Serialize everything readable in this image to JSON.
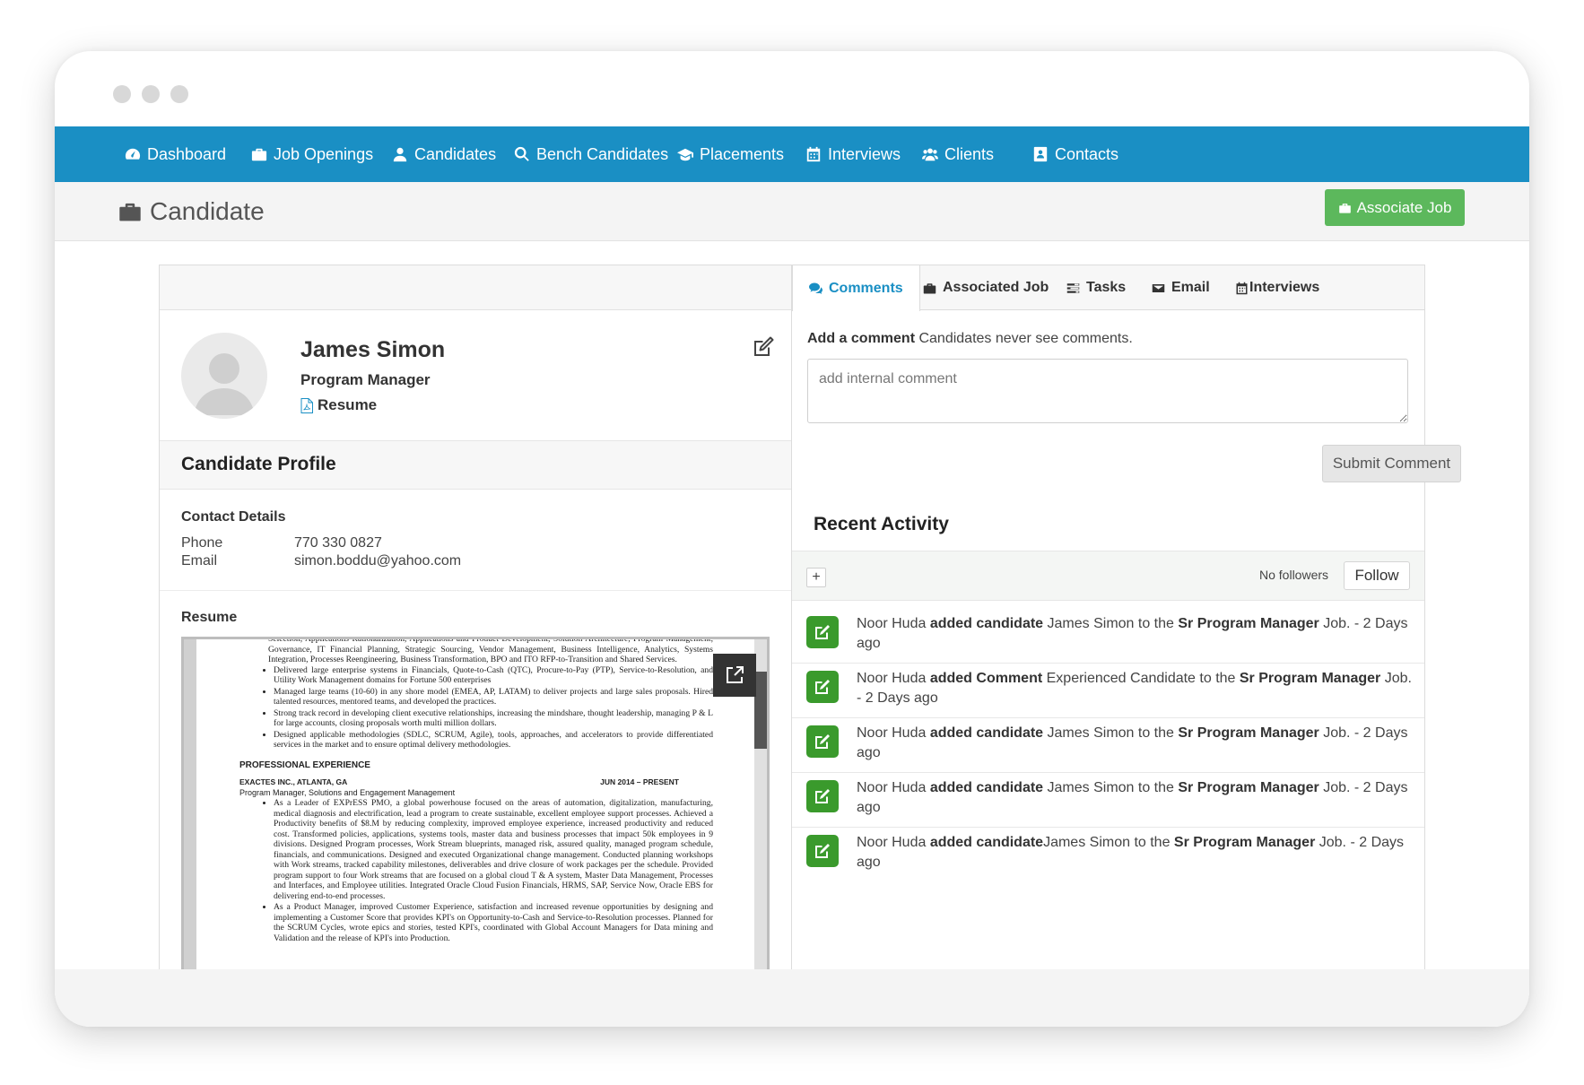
{
  "nav": {
    "items": [
      {
        "label": "Dashboard",
        "icon": "dashboard-icon"
      },
      {
        "label": "Job Openings",
        "icon": "briefcase-icon"
      },
      {
        "label": "Candidates",
        "icon": "user-icon"
      },
      {
        "label": "Bench Candidates",
        "icon": "search-icon"
      },
      {
        "label": "Placements",
        "icon": "graduation-cap-icon"
      },
      {
        "label": "Interviews",
        "icon": "calendar-icon"
      },
      {
        "label": "Clients",
        "icon": "users-icon"
      },
      {
        "label": "Contacts",
        "icon": "contact-book-icon"
      }
    ]
  },
  "header": {
    "title": "Candidate",
    "associate_job_label": "Associate Job"
  },
  "candidate": {
    "name": "James Simon",
    "title": "Program Manager",
    "resume_link": "Resume",
    "profile_heading": "Candidate Profile",
    "contact_heading": "Contact Details",
    "phone_label": "Phone",
    "phone": "770 330 0827",
    "email_label": "Email",
    "email": "simon.boddu@yahoo.com",
    "resume_heading": "Resume"
  },
  "resume_doc": {
    "line_top": "Selection, Applications Rationalization, Applications and Product Development, Solution Architecture, Program Management, Governance, IT Financial Planning, Strategic Sourcing, Vendor Management, Business Intelligence, Analytics, Systems Integration, Processes Reengineering, Business Transformation, BPO and ITO RFP-to-Transition and Shared Services.",
    "bullets_top": [
      "Delivered large enterprise systems in Financials, Quote-to-Cash (QTC), Procure-to-Pay (PTP), Service-to-Resolution, and Utility Work Management domains for Fortune 500 enterprises",
      "Managed large teams (10-60) in any shore model (EMEA, AP, LATAM) to deliver projects and large sales proposals. Hired talented resources, mentored teams, and developed the practices.",
      "Strong track record in developing client executive relationships, increasing the mindshare, thought leadership, managing P & L for large accounts, closing proposals worth multi million dollars.",
      "Designed applicable methodologies (SDLC, SCRUM, Agile), tools, approaches, and accelerators to provide differentiated services in the market and to ensure optimal delivery methodologies."
    ],
    "section": "PROFESSIONAL EXPERIENCE",
    "company": "EXACTES INC., ATLANTA, GA",
    "dates": "JUN 2014 – PRESENT",
    "role": "Program Manager, Solutions and Engagement Management",
    "bullets_exp": [
      "As a Leader of EXPrESS PMO, a global powerhouse focused on the areas of automation, digitalization, manufacturing, medical diagnosis and electrification, lead a program to create sustainable, excellent employee support processes. Achieved a Productivity benefits of $8.M by reducing complexity, improved employee experience, increased productivity and reduced cost. Transformed policies, applications, systems tools, master data and business processes that impact 50k employees in 9 divisions. Designed Program processes, Work Stream blueprints, managed risk, assured quality, managed program schedule, financials, and communications. Designed and executed Organizational change management. Conducted planning workshops with Work streams, tracked capability milestones, deliverables and drive closure of work packages per the schedule. Provided program support to four Work streams that are focused on a global cloud T & A system, Master Data Management, Processes and Interfaces, and Employee utilities. Integrated Oracle Cloud Fusion Financials, HRMS, SAP, Service Now, Oracle EBS for delivering end-to-end processes.",
      "As a Product Manager, improved Customer Experience, satisfaction and increased revenue opportunities by designing and implementing a Customer Score that provides KPI's on Opportunity-to-Cash and Service-to-Resolution processes. Planned for the SCRUM Cycles, wrote epics and stories, tested KPI's, coordinated with Global Account Managers for Data mining and Validation and the release of KPI's into Production."
    ]
  },
  "tabs": [
    {
      "label": "Comments",
      "icon": "comments-icon"
    },
    {
      "label": "Associated Job",
      "icon": "briefcase-icon"
    },
    {
      "label": "Tasks",
      "icon": "tasks-icon"
    },
    {
      "label": "Email",
      "icon": "envelope-icon"
    },
    {
      "label": "Interviews",
      "icon": "calendar-icon"
    }
  ],
  "comments": {
    "add_label": "Add a comment",
    "hint": "Candidates never see comments.",
    "placeholder": "add internal comment",
    "submit_label": "Submit Comment"
  },
  "activity": {
    "heading": "Recent Activity",
    "add_label": "+",
    "followers_text": "No followers",
    "follow_label": "Follow",
    "items": [
      {
        "actor": "Noor Huda ",
        "action": "added candidate",
        "object": " James Simon to the ",
        "job": "Sr Program Manager",
        "tail": " Job. - 2 Days ago"
      },
      {
        "actor": "Noor Huda ",
        "action": "added Comment",
        "object": " Experienced Candidate to the ",
        "job": "Sr Program Manager",
        "tail": " Job. - 2 Days ago"
      },
      {
        "actor": "Noor Huda ",
        "action": "added candidate",
        "object": " James Simon to the ",
        "job": "Sr Program Manager",
        "tail": " Job. - 2 Days ago"
      },
      {
        "actor": "Noor Huda ",
        "action": "added candidate",
        "object": " James Simon to the ",
        "job": "Sr Program Manager",
        "tail": " Job. - 2 Days ago"
      },
      {
        "actor": "Noor Huda ",
        "action": "added candidate",
        "object": "James Simon to the ",
        "job": "Sr Program Manager",
        "tail": " Job. - 2 Days ago"
      }
    ]
  },
  "colors": {
    "nav_bg": "#1a8fc4",
    "accent_green": "#5cb85c",
    "activity_icon": "#3a9a2c"
  }
}
